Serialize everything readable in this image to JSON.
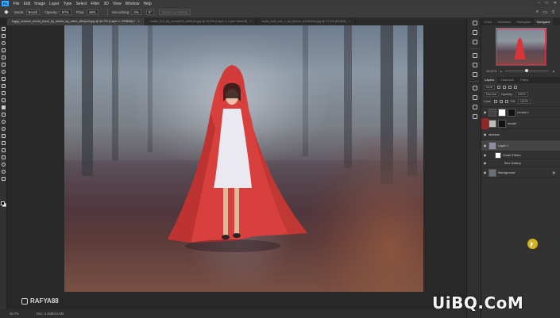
{
  "menubar": {
    "items": [
      "File",
      "Edit",
      "Image",
      "Layer",
      "Type",
      "Select",
      "Filter",
      "3D",
      "View",
      "Window",
      "Help"
    ],
    "window_buttons": [
      "–",
      "□",
      "✕"
    ]
  },
  "options": {
    "mode_label": "Mode:",
    "mode_value": "Brush",
    "opacity_label": "Opacity:",
    "opacity_value": "57%",
    "flow_label": "Flow:",
    "flow_value": "49%",
    "smoothing_label": "Smoothing:",
    "smoothing_value": "0%",
    "angle_value": "0°",
    "erase_history": "Erase to History"
  },
  "tabs": [
    {
      "label": "foggy_autumn_forest_stock_by_adobe_by_arthe_d5hq1hf.jpg @ 46.7% (Layer 1, RGB/8#) *",
      "active": true
    },
    {
      "label": "model_011_by_anonbr23_db5h1t4.jpg @ 26.9% (Layer 1, Layer Mask/8)",
      "active": false
    },
    {
      "label": "arctic_wolf_cub_1_by_forlorn_d4u2b2ab.jpg @ 27.5% (RGB/8)",
      "active": false
    }
  ],
  "watermark": "RAFYA88",
  "status": {
    "zoom": "46.7%",
    "doc": "Doc: 3.46M/14.9M"
  },
  "panels": {
    "top_tabs": [
      "Color",
      "Swatches",
      "Histogram",
      "Navigator"
    ],
    "zoom_pct": "46.67%",
    "layer_tabs": [
      "Layers",
      "Channels",
      "Paths"
    ],
    "kind_label": "Kind",
    "blend_mode": "Normal",
    "opacity_label": "Opacity:",
    "opacity_value": "100%",
    "lock_label": "Lock:",
    "fill_label": "Fill:",
    "fill_value": "100%",
    "layers": [
      {
        "name": "Levels 1"
      },
      {
        "name": "model"
      },
      {
        "name": "shadow"
      },
      {
        "name": "Layer 1"
      },
      {
        "name": "Smart Filters"
      },
      {
        "name": "Blur Gallery"
      },
      {
        "name": "Background"
      }
    ]
  },
  "brand": "UiBQ.CoM"
}
